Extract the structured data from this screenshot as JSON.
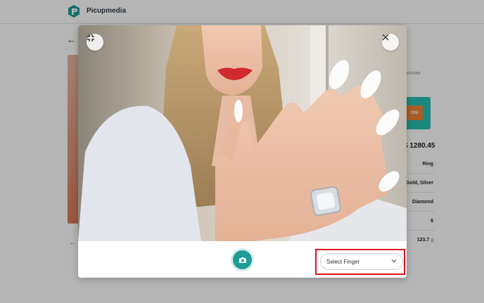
{
  "app": {
    "brand_name": "Picupmedia",
    "brand_color": "#1e9c96"
  },
  "background_page": {
    "merchant_text": "mman",
    "banner_button_label": "ON!",
    "price": "$ 1280.45",
    "specs": [
      {
        "value": "Ring"
      },
      {
        "value": "Gold, Silver"
      },
      {
        "value": "Diamond"
      },
      {
        "value": "6"
      },
      {
        "value": "123.7",
        "unit": "g"
      }
    ]
  },
  "modal": {
    "minimize_icon": "minimize-icon",
    "close_icon": "close-icon",
    "capture_icon": "camera-icon",
    "finger_select": {
      "placeholder": "Select Finger",
      "icon": "chevron-down-icon"
    },
    "highlight_color": "#e0141b"
  }
}
